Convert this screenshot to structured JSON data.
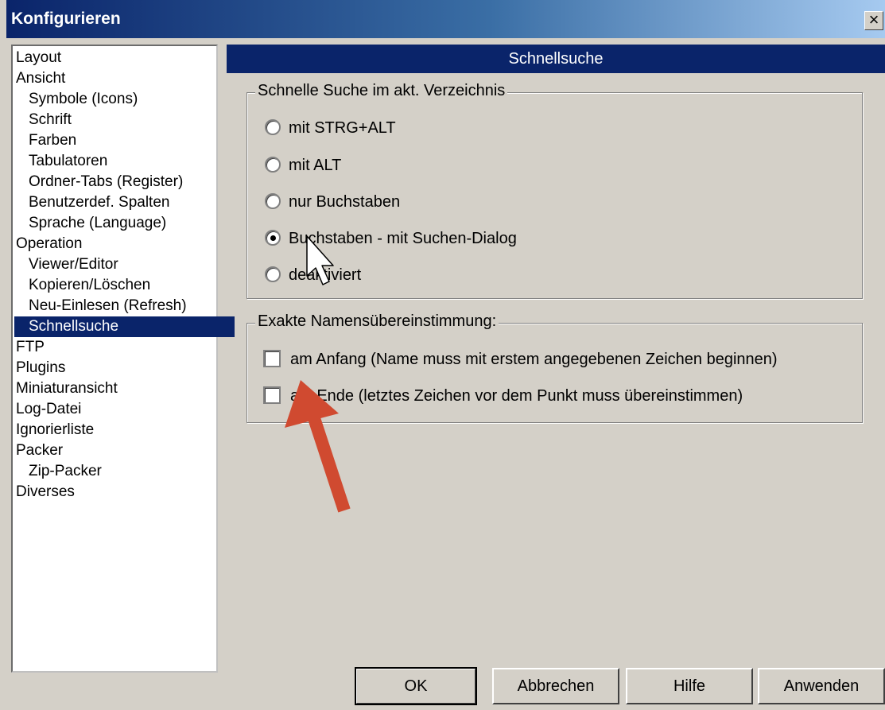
{
  "window": {
    "title": "Konfigurieren",
    "close_label": "×"
  },
  "tree": {
    "items": [
      {
        "label": "Layout",
        "level": 0
      },
      {
        "label": "Ansicht",
        "level": 0
      },
      {
        "label": "Symbole (Icons)",
        "level": 1
      },
      {
        "label": "Schrift",
        "level": 1
      },
      {
        "label": "Farben",
        "level": 1
      },
      {
        "label": "Tabulatoren",
        "level": 1
      },
      {
        "label": "Ordner-Tabs (Register)",
        "level": 1
      },
      {
        "label": "Benutzerdef. Spalten",
        "level": 1
      },
      {
        "label": "Sprache (Language)",
        "level": 1
      },
      {
        "label": "Operation",
        "level": 0
      },
      {
        "label": "Viewer/Editor",
        "level": 1
      },
      {
        "label": "Kopieren/Löschen",
        "level": 1
      },
      {
        "label": "Neu-Einlesen (Refresh)",
        "level": 1
      },
      {
        "label": "Schnellsuche",
        "level": 1,
        "selected": true
      },
      {
        "label": "FTP",
        "level": 0
      },
      {
        "label": "Plugins",
        "level": 0
      },
      {
        "label": "Miniaturansicht",
        "level": 0
      },
      {
        "label": "Log-Datei",
        "level": 0
      },
      {
        "label": "Ignorierliste",
        "level": 0
      },
      {
        "label": "Packer",
        "level": 0
      },
      {
        "label": "Zip-Packer",
        "level": 1
      },
      {
        "label": "Diverses",
        "level": 0
      }
    ]
  },
  "panel": {
    "title": "Schnellsuche",
    "quick_search_group": {
      "legend": "Schnelle Suche im akt. Verzeichnis",
      "options": [
        {
          "label": "mit STRG+ALT",
          "checked": false
        },
        {
          "label": "mit ALT",
          "checked": false
        },
        {
          "label": "nur Buchstaben",
          "checked": false
        },
        {
          "label": "Buchstaben - mit Suchen-Dialog",
          "checked": true
        },
        {
          "label": "deaktiviert",
          "checked": false
        }
      ]
    },
    "exact_match_group": {
      "legend": "Exakte Namensübereinstimmung:",
      "options": [
        {
          "label": "am Anfang (Name muss mit erstem angegebenen Zeichen beginnen)",
          "checked": false
        },
        {
          "label": "am Ende (letztes Zeichen vor dem Punkt muss übereinstimmen)",
          "checked": false
        }
      ]
    }
  },
  "buttons": {
    "ok": "OK",
    "cancel": "Abbrechen",
    "help": "Hilfe",
    "apply": "Anwenden"
  },
  "colors": {
    "selection": "#0a246a",
    "annotation_arrow": "#d04a30"
  }
}
